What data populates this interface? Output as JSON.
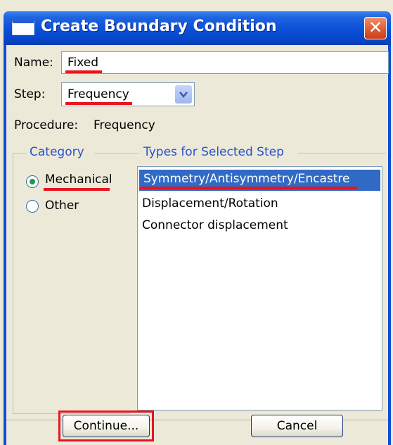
{
  "window": {
    "title": "Create Boundary Condition",
    "close_glyph": "✕"
  },
  "form": {
    "name_label": "Name:",
    "name_value": "Fixed",
    "step_label": "Step:",
    "step_value": "Frequency",
    "procedure_label": "Procedure:",
    "procedure_value": "Frequency"
  },
  "category": {
    "heading": "Category",
    "options": [
      {
        "label": "Mechanical",
        "checked": true
      },
      {
        "label": "Other",
        "checked": false
      }
    ]
  },
  "types": {
    "heading": "Types for Selected Step",
    "items": [
      {
        "label": "Symmetry/Antisymmetry/Encastre",
        "selected": true
      },
      {
        "label": "Displacement/Rotation",
        "selected": false
      },
      {
        "label": "Connector displacement",
        "selected": false
      }
    ]
  },
  "buttons": {
    "continue_label": "Continue...",
    "cancel_label": "Cancel"
  },
  "colors": {
    "titlebar": "#0a4fd6",
    "selection": "#316ac5",
    "annotation_red": "#e8141e",
    "group_heading": "#2a53c8"
  }
}
